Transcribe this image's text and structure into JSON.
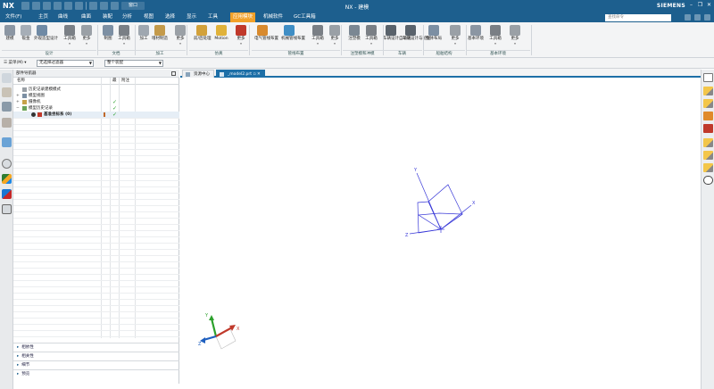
{
  "app": {
    "logo": "NX",
    "window_title": "NX - 建模",
    "brand": "SIEMENS",
    "window_switch": "窗口"
  },
  "menu": {
    "items": [
      "文件(F)",
      "主页",
      "曲线",
      "曲面",
      "装配",
      "分析",
      "视图",
      "选择",
      "显示",
      "工具",
      "应用模块",
      "机械软件",
      "GC工具箱"
    ],
    "active_index": 10,
    "search_placeholder": "查找命令"
  },
  "ribbon": {
    "buttons": [
      {
        "label": "建模",
        "icon": "modeling-icon"
      },
      {
        "label": "钣金",
        "icon": "sheet-metal-icon"
      },
      {
        "label": "外观造型设计",
        "icon": "shape-studio-icon"
      },
      {
        "label": "工具箱",
        "icon": "toolbox-icon",
        "dropdown": true
      },
      {
        "label": "更多",
        "icon": "more-icon",
        "dropdown": true
      },
      {
        "label": "制图",
        "icon": "drafting-icon"
      },
      {
        "label": "工具箱",
        "icon": "toolbox-icon",
        "dropdown": true
      },
      {
        "label": "加工",
        "icon": "machining-icon"
      },
      {
        "label": "增材制造",
        "icon": "additive-icon"
      },
      {
        "label": "更多",
        "icon": "more-icon",
        "dropdown": true
      },
      {
        "label": "前/后处理",
        "icon": "pre-post-icon"
      },
      {
        "label": "Motion",
        "icon": "motion-icon"
      },
      {
        "label": "更多",
        "icon": "more-icon",
        "dropdown": true
      },
      {
        "label": "电气管线布置",
        "icon": "electrical-routing-icon"
      },
      {
        "label": "机械管线布置",
        "icon": "mechanical-routing-icon"
      },
      {
        "label": "工具箱",
        "icon": "toolbox-icon",
        "dropdown": true
      },
      {
        "label": "更多",
        "icon": "more-icon",
        "dropdown": true
      },
      {
        "label": "注塑模",
        "icon": "mold-icon"
      },
      {
        "label": "工具箱",
        "icon": "toolbox-icon",
        "dropdown": true
      },
      {
        "label": "车辆设计自动化",
        "icon": "vehicle-design-icon"
      },
      {
        "label": "车辆设计与验证",
        "icon": "vehicle-validation-icon"
      },
      {
        "label": "整体布局",
        "icon": "layout-icon"
      },
      {
        "label": "更多",
        "icon": "more-icon",
        "dropdown": true
      },
      {
        "label": "基本环境",
        "icon": "base-environment-icon"
      },
      {
        "label": "工具箱",
        "icon": "toolbox-icon",
        "dropdown": true
      },
      {
        "label": "更多",
        "icon": "more-icon",
        "dropdown": true
      }
    ],
    "groups": [
      "设计",
      "文档",
      "加工",
      "仿真",
      "管线布置",
      "注塑模和冲模",
      "车辆",
      "船舶结构",
      "基本环境"
    ]
  },
  "filterbar": {
    "menu_label": "菜单(M)",
    "type_filter": "无选择过滤器",
    "scope": "整个装配"
  },
  "navigator": {
    "title": "部件导航器",
    "columns": [
      "名称",
      "",
      "最",
      "附注"
    ],
    "rows": [
      {
        "text": "历史记录建模模式",
        "icon": "clock-icon",
        "level": 0,
        "ok": false
      },
      {
        "text": "模型视图",
        "icon": "model-views-icon",
        "level": 0,
        "expand": "+",
        "ok": false
      },
      {
        "text": "摄像机",
        "icon": "camera-icon",
        "level": 0,
        "expand": "+",
        "ok": true
      },
      {
        "text": "模型历史记录",
        "icon": "history-icon",
        "level": 0,
        "expand": "−",
        "ok": true
      },
      {
        "text": "基准坐标系 (0)",
        "icon": "datum-csys-icon",
        "level": 1,
        "ok": true,
        "bold": true
      }
    ],
    "sections": [
      "相依性",
      "相关性",
      "细节",
      "预览"
    ]
  },
  "tabs": [
    {
      "label": "资源中心",
      "active": false
    },
    {
      "label": "_model2.prt",
      "active": true
    }
  ],
  "colors": {
    "title_bar": "#1d5f8e",
    "active_menu": "#f2a12a",
    "active_tab": "#1d6fa7",
    "csys_blue": "#3a3ad8",
    "axis_x": "#c0392b",
    "axis_y": "#2ca02c",
    "axis_z": "#1f5fbf"
  },
  "viewport": {
    "axis_labels": {
      "x": "X",
      "y": "Y",
      "z": "Z"
    }
  }
}
